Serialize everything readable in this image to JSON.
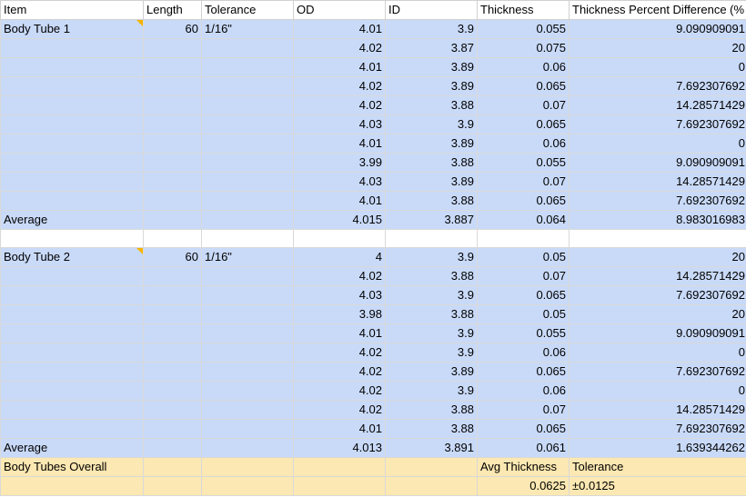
{
  "headers": [
    "Item",
    "Length",
    "Tolerance",
    "OD",
    "ID",
    "Thickness",
    "Thickness Percent Difference (%"
  ],
  "tube1": {
    "rows": [
      [
        "Body Tube 1",
        "60",
        "1/16\"",
        "4.01",
        "3.9",
        "0.055",
        "9.090909091"
      ],
      [
        "",
        "",
        "",
        "4.02",
        "3.87",
        "0.075",
        "20"
      ],
      [
        "",
        "",
        "",
        "4.01",
        "3.89",
        "0.06",
        "0"
      ],
      [
        "",
        "",
        "",
        "4.02",
        "3.89",
        "0.065",
        "7.692307692"
      ],
      [
        "",
        "",
        "",
        "4.02",
        "3.88",
        "0.07",
        "14.28571429"
      ],
      [
        "",
        "",
        "",
        "4.03",
        "3.9",
        "0.065",
        "7.692307692"
      ],
      [
        "",
        "",
        "",
        "4.01",
        "3.89",
        "0.06",
        "0"
      ],
      [
        "",
        "",
        "",
        "3.99",
        "3.88",
        "0.055",
        "9.090909091"
      ],
      [
        "",
        "",
        "",
        "4.03",
        "3.89",
        "0.07",
        "14.28571429"
      ],
      [
        "",
        "",
        "",
        "4.01",
        "3.88",
        "0.065",
        "7.692307692"
      ],
      [
        "Average",
        "",
        "",
        "4.015",
        "3.887",
        "0.064",
        "8.983016983"
      ]
    ]
  },
  "tube2": {
    "rows": [
      [
        "Body Tube 2",
        "60",
        "1/16\"",
        "4",
        "3.9",
        "0.05",
        "20"
      ],
      [
        "",
        "",
        "",
        "4.02",
        "3.88",
        "0.07",
        "14.28571429"
      ],
      [
        "",
        "",
        "",
        "4.03",
        "3.9",
        "0.065",
        "7.692307692"
      ],
      [
        "",
        "",
        "",
        "3.98",
        "3.88",
        "0.05",
        "20"
      ],
      [
        "",
        "",
        "",
        "4.01",
        "3.9",
        "0.055",
        "9.090909091"
      ],
      [
        "",
        "",
        "",
        "4.02",
        "3.9",
        "0.06",
        "0"
      ],
      [
        "",
        "",
        "",
        "4.02",
        "3.89",
        "0.065",
        "7.692307692"
      ],
      [
        "",
        "",
        "",
        "4.02",
        "3.9",
        "0.06",
        "0"
      ],
      [
        "",
        "",
        "",
        "4.02",
        "3.88",
        "0.07",
        "14.28571429"
      ],
      [
        "",
        "",
        "",
        "4.01",
        "3.88",
        "0.065",
        "7.692307692"
      ],
      [
        "Average",
        "",
        "",
        "4.013",
        "3.891",
        "0.061",
        "1.639344262"
      ]
    ]
  },
  "overall": {
    "rows": [
      [
        "Body Tubes Overall",
        "",
        "",
        "",
        "",
        "Avg Thickness",
        "Tolerance"
      ],
      [
        "",
        "",
        "",
        "",
        "",
        "0.0625",
        "±0.0125"
      ]
    ]
  },
  "colors": {
    "data_fill": "#c9daf8",
    "summary_fill": "#fce8b2",
    "note_marker": "#f4b400"
  }
}
